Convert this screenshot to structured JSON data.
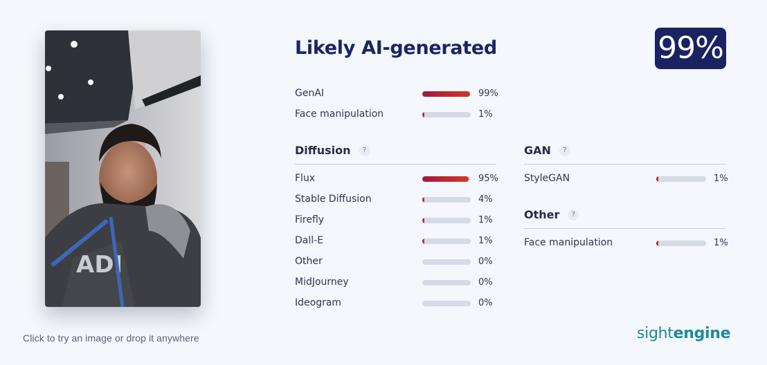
{
  "upload": {
    "hint": "Click to try an image or drop it anywhere"
  },
  "result": {
    "verdict": "Likely AI-generated",
    "score": "99%",
    "summary": [
      {
        "label": "GenAI",
        "value": 99,
        "pct": "99%"
      },
      {
        "label": "Face manipulation",
        "value": 1,
        "pct": "1%"
      }
    ]
  },
  "sections": {
    "diffusion": {
      "title": "Diffusion",
      "help": "?",
      "items": [
        {
          "label": "Flux",
          "value": 95,
          "pct": "95%"
        },
        {
          "label": "Stable Diffusion",
          "value": 4,
          "pct": "4%"
        },
        {
          "label": "Firefly",
          "value": 1,
          "pct": "1%"
        },
        {
          "label": "Dall-E",
          "value": 1,
          "pct": "1%"
        },
        {
          "label": "Other",
          "value": 0,
          "pct": "0%"
        },
        {
          "label": "MidJourney",
          "value": 0,
          "pct": "0%"
        },
        {
          "label": "Ideogram",
          "value": 0,
          "pct": "0%"
        }
      ]
    },
    "gan": {
      "title": "GAN",
      "help": "?",
      "items": [
        {
          "label": "StyleGAN",
          "value": 1,
          "pct": "1%"
        }
      ]
    },
    "other": {
      "title": "Other",
      "help": "?",
      "items": [
        {
          "label": "Face manipulation",
          "value": 1,
          "pct": "1%"
        }
      ]
    }
  },
  "brand": {
    "light": "sight",
    "bold": "engine"
  },
  "colors": {
    "accent_navy": "#1b2262",
    "bar_fill_start": "#a41a3e",
    "bar_fill_end": "#d33628",
    "bar_track": "#d4dbe7",
    "brand_teal": "#1e8a9a"
  }
}
